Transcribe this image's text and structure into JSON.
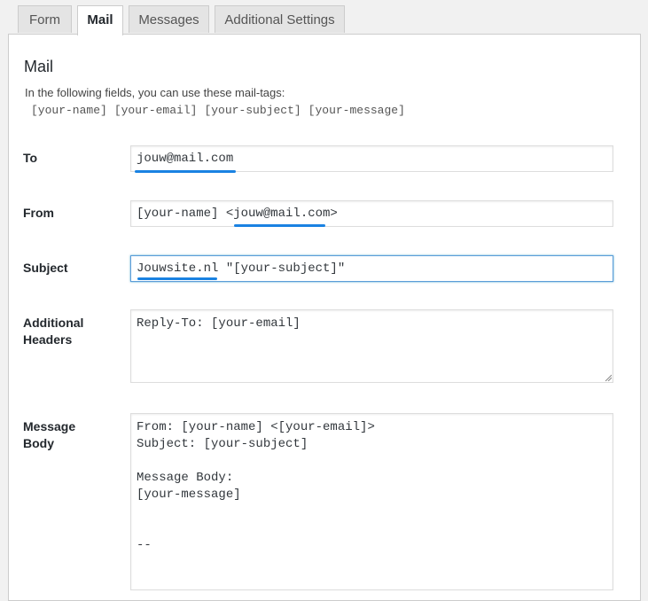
{
  "tabs": [
    {
      "label": "Form"
    },
    {
      "label": "Mail"
    },
    {
      "label": "Messages"
    },
    {
      "label": "Additional Settings"
    }
  ],
  "panel": {
    "title": "Mail",
    "intro": "In the following fields, you can use these mail-tags:",
    "mailtags": [
      "[your-name]",
      "[your-email]",
      "[your-subject]",
      "[your-message]"
    ]
  },
  "fields": {
    "to": {
      "label": "To",
      "value": "jouw@mail.com"
    },
    "from": {
      "label": "From",
      "value": "[your-name] <jouw@mail.com>"
    },
    "subject": {
      "label": "Subject",
      "value": "Jouwsite.nl \"[your-subject]\""
    },
    "additional_headers": {
      "label_line1": "Additional",
      "label_line2": "Headers",
      "value": "Reply-To: [your-email]"
    },
    "message_body": {
      "label_line1": "Message",
      "label_line2": "Body",
      "value": "From: [your-name] <[your-email]>\nSubject: [your-subject]\n\nMessage Body:\n[your-message]\n\n\n--"
    }
  },
  "colors": {
    "accent_underline": "#1a82e2",
    "focus_border": "#5b9dd9"
  }
}
